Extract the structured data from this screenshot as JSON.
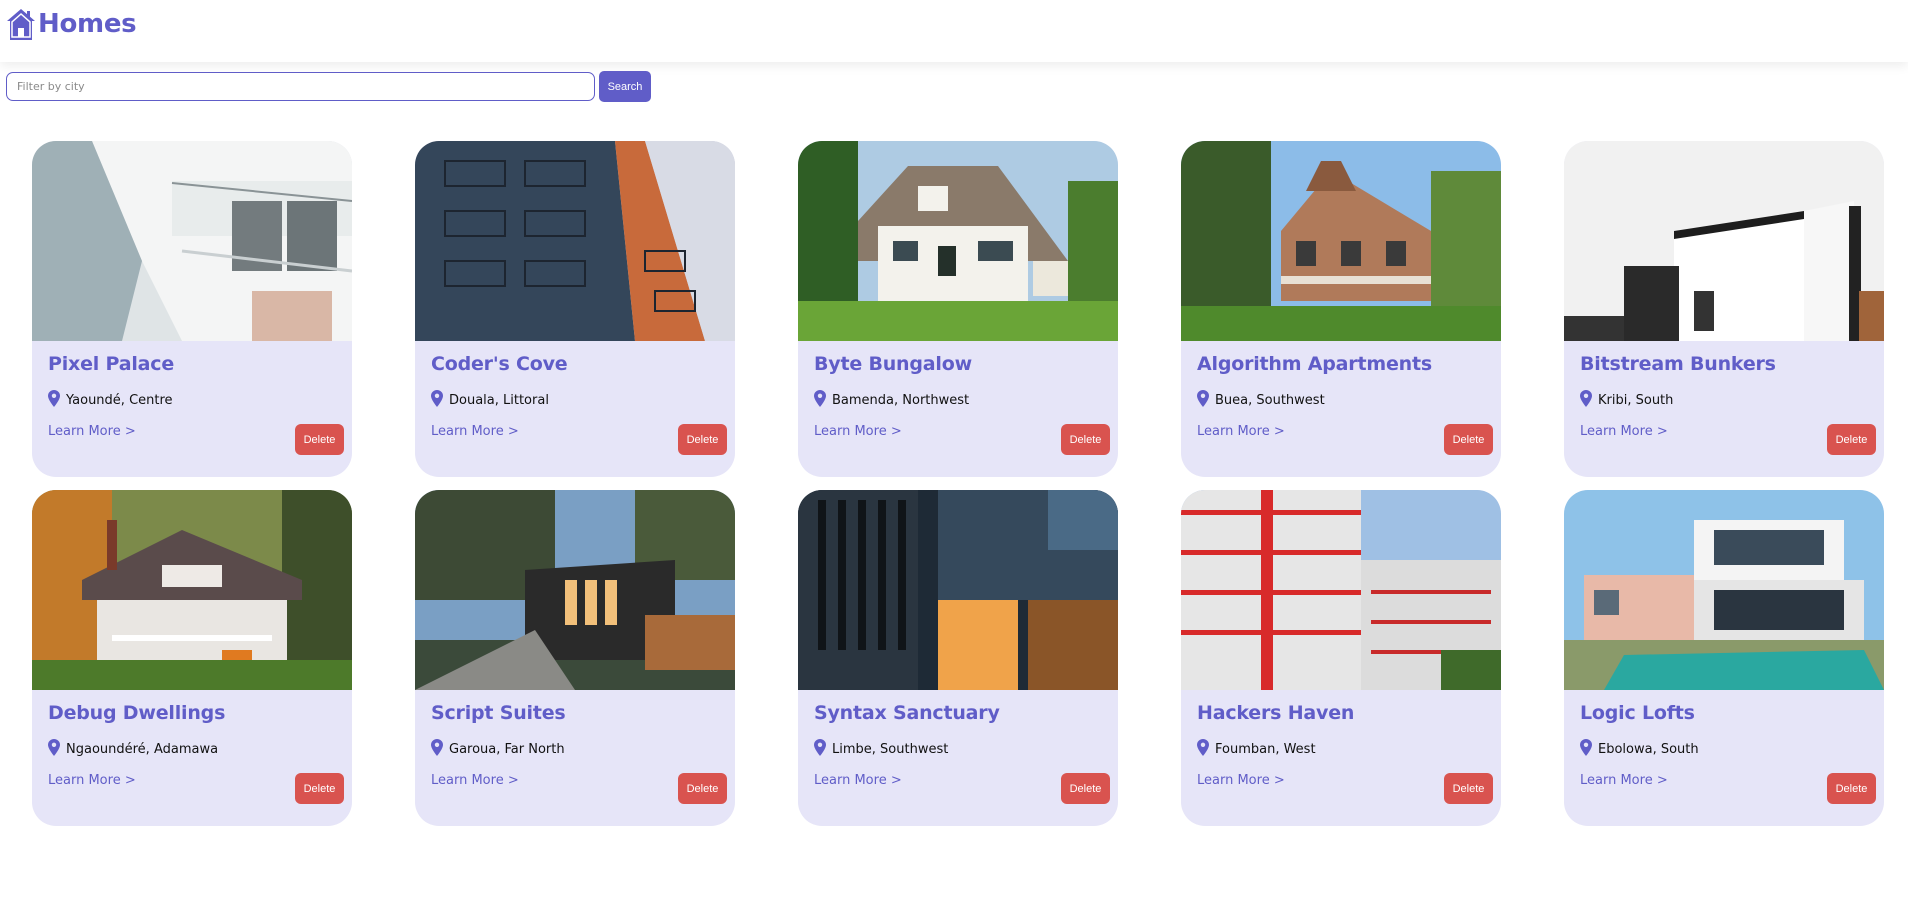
{
  "header": {
    "icon": "house-icon",
    "title": "Homes"
  },
  "search": {
    "placeholder": "Filter by city",
    "value": "",
    "button_label": "Search"
  },
  "colors": {
    "primary": "#605dc8",
    "card_bg": "#e6e5f8",
    "delete": "#d9534f"
  },
  "listings": [
    {
      "title": "Pixel Palace",
      "location": "Yaoundé, Centre",
      "learn_more": "Learn More >",
      "delete_label": "Delete"
    },
    {
      "title": "Coder's Cove",
      "location": "Douala, Littoral",
      "learn_more": "Learn More >",
      "delete_label": "Delete"
    },
    {
      "title": "Byte Bungalow",
      "location": "Bamenda, Northwest",
      "learn_more": "Learn More >",
      "delete_label": "Delete"
    },
    {
      "title": "Algorithm Apartments",
      "location": "Buea, Southwest",
      "learn_more": "Learn More >",
      "delete_label": "Delete"
    },
    {
      "title": "Bitstream Bunkers",
      "location": "Kribi, South",
      "learn_more": "Learn More >",
      "delete_label": "Delete"
    },
    {
      "title": "Debug Dwellings",
      "location": "Ngaoundéré, Adamawa",
      "learn_more": "Learn More >",
      "delete_label": "Delete"
    },
    {
      "title": "Script Suites",
      "location": "Garoua, Far North",
      "learn_more": "Learn More >",
      "delete_label": "Delete"
    },
    {
      "title": "Syntax Sanctuary",
      "location": "Limbe, Southwest",
      "learn_more": "Learn More >",
      "delete_label": "Delete"
    },
    {
      "title": "Hackers Haven",
      "location": "Foumban, West",
      "learn_more": "Learn More >",
      "delete_label": "Delete"
    },
    {
      "title": "Logic Lofts",
      "location": "Ebolowa, South",
      "learn_more": "Learn More >",
      "delete_label": "Delete"
    }
  ]
}
